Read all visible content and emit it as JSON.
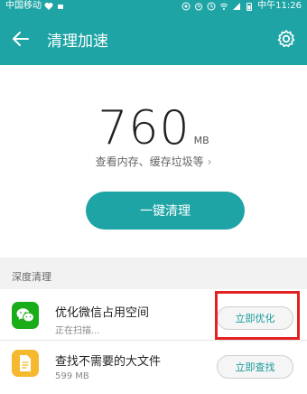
{
  "status_bar": {
    "carrier": "中国移动",
    "time": "中午11:26"
  },
  "app_bar": {
    "title": "清理加速",
    "back_icon": "back-arrow-icon",
    "settings_icon": "gear-icon"
  },
  "hero": {
    "size_value": "760",
    "size_unit": "MB",
    "detail_link": "查看内存、缓存垃圾等"
  },
  "clean_button_label": "一键清理",
  "section_header": "深度清理",
  "items": [
    {
      "title": "优化微信占用空间",
      "subtitle": "正在扫描...",
      "button": "立即优化",
      "icon": "wechat-icon",
      "icon_color": "#1aad19"
    },
    {
      "title": "查找不需要的大文件",
      "subtitle": "599 MB",
      "button": "立即查找",
      "icon": "file-icon",
      "icon_color": "#f5b82e"
    }
  ],
  "colors": {
    "accent": "#1fa4a6",
    "highlight": "#e22222"
  }
}
